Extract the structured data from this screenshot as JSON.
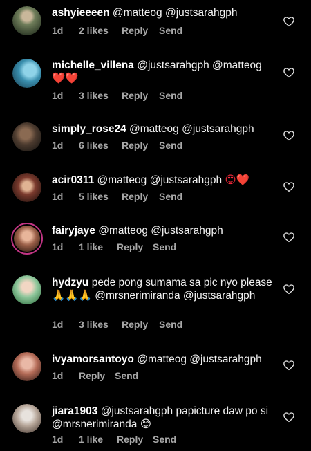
{
  "comments": [
    {
      "user": "ashyieeeen",
      "text": "@matteog  @justsarahgph",
      "time": "1d",
      "likes": "2 likes",
      "reply": "Reply",
      "send": "Send"
    },
    {
      "user": "michelle_villena",
      "text": "@justsarahgph  @matteog",
      "emoji": "❤️❤️",
      "time": "1d",
      "likes": "3 likes",
      "reply": "Reply",
      "send": "Send"
    },
    {
      "user": "simply_rose24",
      "text": "@matteog @justsarahgph",
      "time": "1d",
      "likes": "6 likes",
      "reply": "Reply",
      "send": "Send"
    },
    {
      "user": "acir0311",
      "text": "@matteog  @justsarahgph",
      "emoji": "😍❤️",
      "time": "1d",
      "likes": "5 likes",
      "reply": "Reply",
      "send": "Send"
    },
    {
      "user": "fairyjaye",
      "text": "@matteog @justsarahgph",
      "time": "1d",
      "likes": "1 like",
      "reply": "Reply",
      "send": "Send"
    },
    {
      "user": "hydzyu",
      "text": "pede pong sumama sa pic nyo please",
      "emoji": "🙏🙏🙏",
      "text2": "@mrsnerimiranda @justsarahgph",
      "time": "1d",
      "likes": "3 likes",
      "reply": "Reply",
      "send": "Send"
    },
    {
      "user": "ivyamorsantoyo",
      "text": "@matteog @justsarahgph",
      "time": "1d",
      "reply": "Reply",
      "send": "Send"
    },
    {
      "user": "jiara1903",
      "text": "@justsarahgph papicture daw po si @mrsnerimiranda",
      "emoji": "😊",
      "time": "1d",
      "likes": "1 like",
      "reply": "Reply",
      "send": "Send"
    }
  ],
  "colors": {
    "background": "#000000",
    "text": "#f2f2f2",
    "meta": "#a8a8a8",
    "story_ring": "#c13584"
  },
  "icons": {
    "like": "heart-outline-icon"
  }
}
